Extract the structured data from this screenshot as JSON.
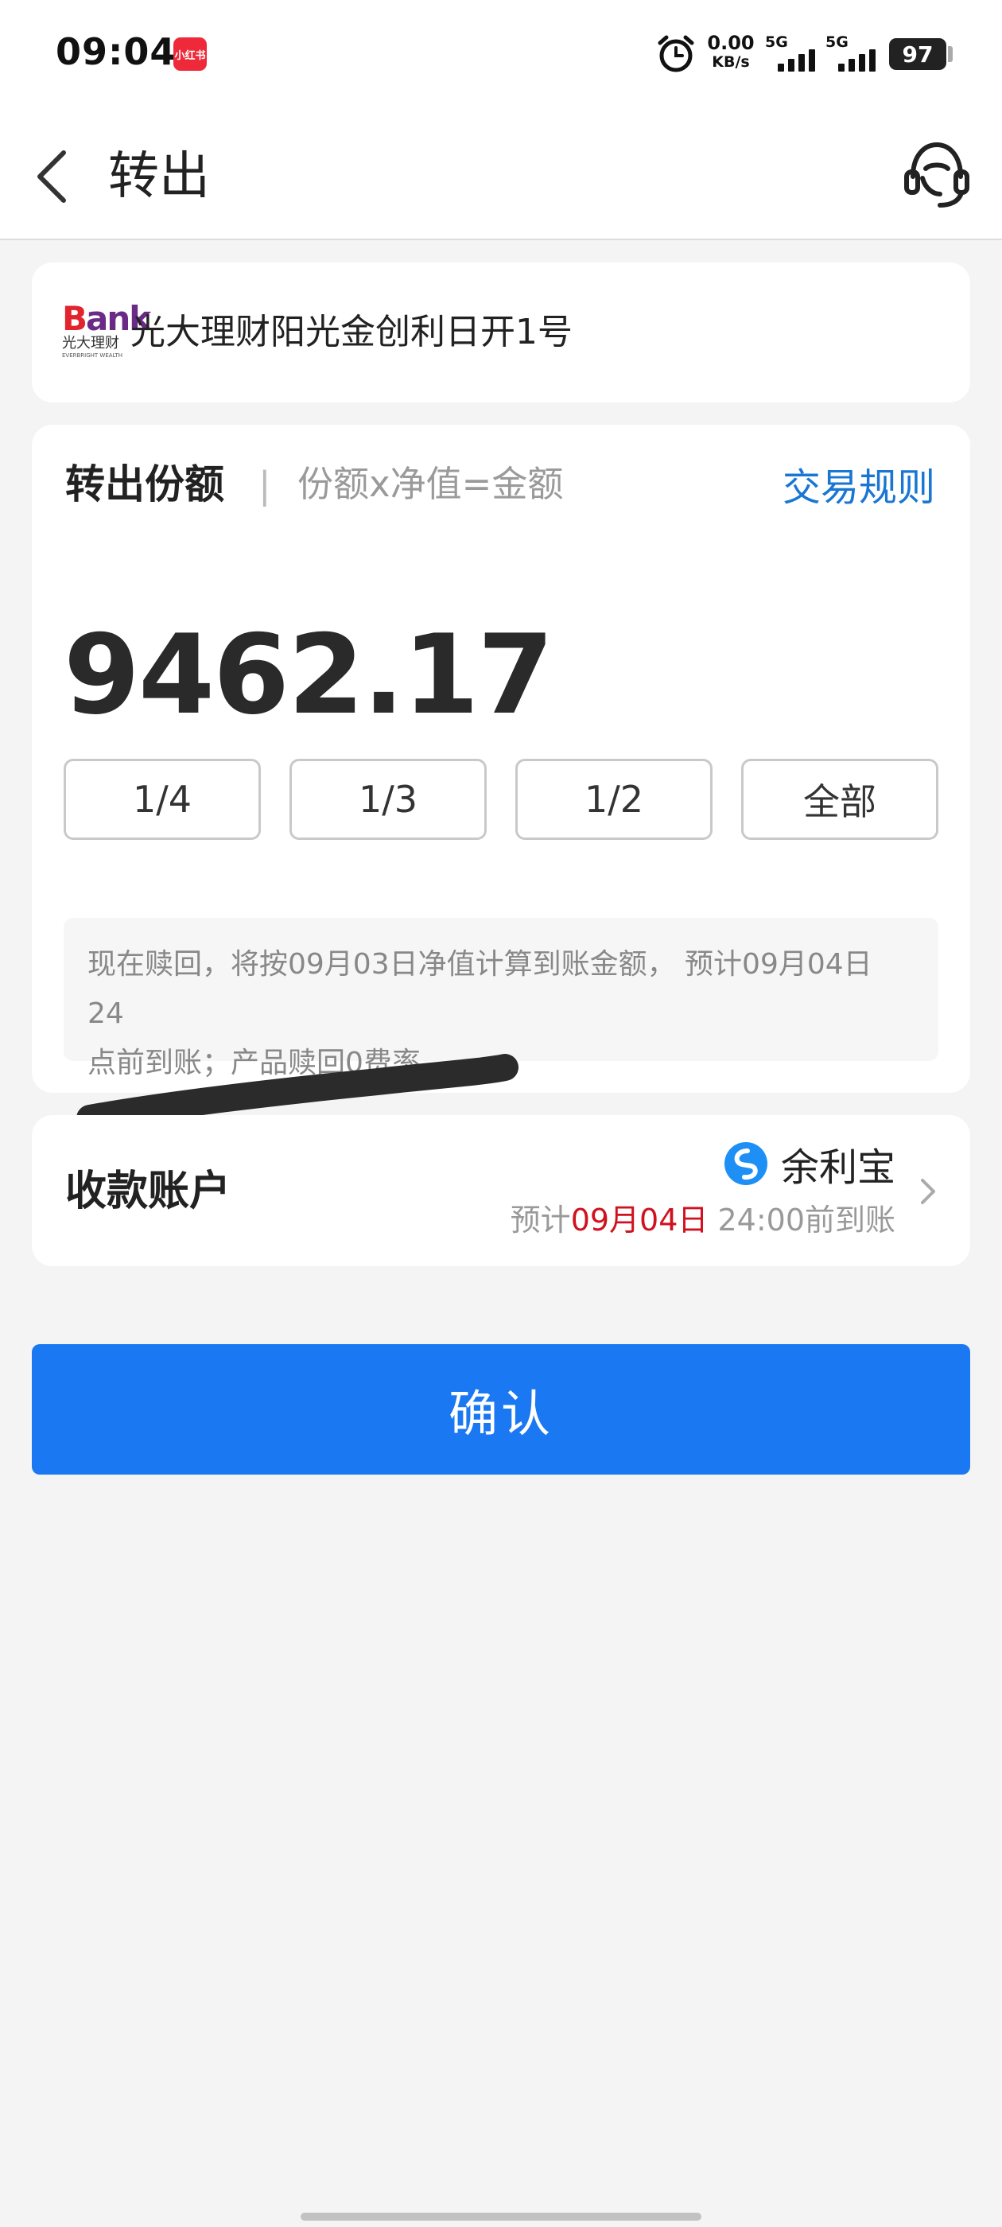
{
  "status_bar": {
    "time": "09:04",
    "app_badge": "小红书",
    "net_speed": "0.00",
    "net_unit": "KB/s",
    "sim1": "5G",
    "sim2": "5G",
    "battery": "97",
    "icons": [
      "alarm-icon",
      "signal-icon",
      "battery-icon"
    ]
  },
  "nav": {
    "title": "转出",
    "back_icon": "chevron-left-icon",
    "service_icon": "headset-icon"
  },
  "product": {
    "logo_text_a": "B",
    "logo_text_b": "ank",
    "logo_cn": "光大理财",
    "logo_en": "EVERBRIGHT WEALTH",
    "name": "光大理财阳光金创利日开1号"
  },
  "transfer": {
    "label": "转出份额",
    "divider": "|",
    "formula": "份额x净值=金额",
    "rules_link": "交易规则",
    "amount": "9462.17",
    "fractions": [
      "1/4",
      "1/3",
      "1/2",
      "全部"
    ],
    "notice_line1": "现在赎回，将按09月03日净值计算到账金额， 预计09月04日 24",
    "notice_line2": "点前到账；产品赎回0费率"
  },
  "account": {
    "label": "收款账户",
    "name": "余利宝",
    "eta_prefix": "预计",
    "eta_date": "09月04日",
    "eta_suffix": " 24:00前到账",
    "chevron_icon": "chevron-right-icon"
  },
  "confirm_label": "确认",
  "colors": {
    "primary": "#1a78f2",
    "link": "#1976d2",
    "highlight_red": "#d0121f",
    "background": "#f4f4f4"
  }
}
